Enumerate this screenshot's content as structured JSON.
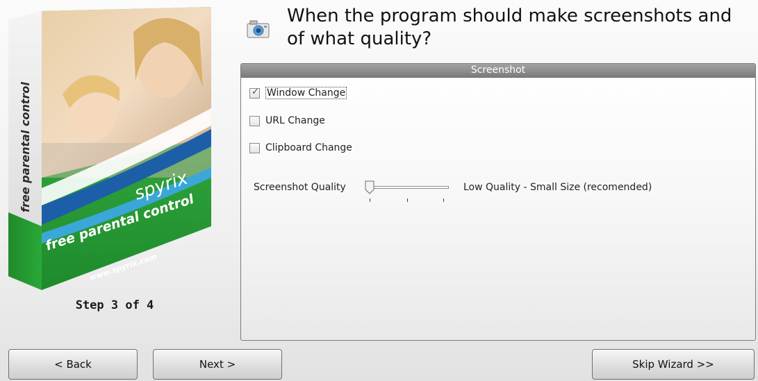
{
  "box": {
    "spine_text": "free parental control",
    "brand": "spyrix",
    "front_text": "free parental control",
    "url": "www.spyrix.com"
  },
  "step_label": "Step 3 of 4",
  "header": {
    "icon": "camera-icon",
    "title": "When the program should make screenshots and of what quality?"
  },
  "panel": {
    "title": "Screenshot",
    "options": [
      {
        "label": "Window Change",
        "checked": true
      },
      {
        "label": "URL Change",
        "checked": false
      },
      {
        "label": "Clipboard Change",
        "checked": false
      }
    ],
    "quality": {
      "label": "Screenshot Quality",
      "level": 0,
      "steps": 3,
      "value_text": "Low Quality - Small Size (recomended)"
    }
  },
  "buttons": {
    "back": "< Back",
    "next": "Next >",
    "skip": "Skip Wizard >>"
  },
  "colors": {
    "brand_green": "#2a9a3a",
    "brand_blue": "#1c5fa8",
    "panel_header": "#8a8a8a"
  }
}
